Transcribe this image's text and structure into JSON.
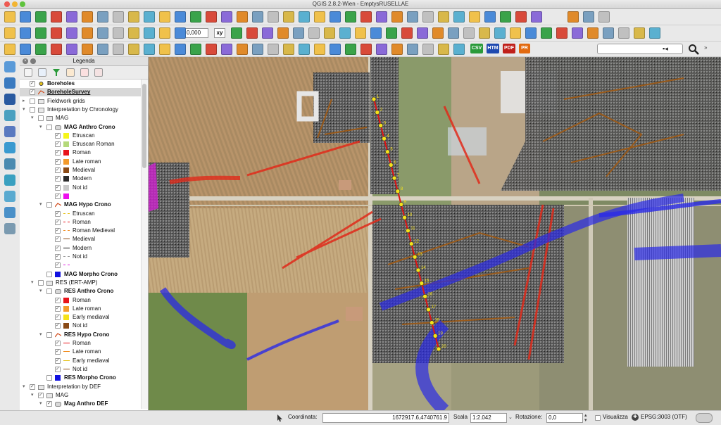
{
  "window": {
    "title": "QGIS 2.8.2-Wien - EmptysRUSELLAE"
  },
  "toolbar": {
    "zoom_factor": "0,000",
    "xy_button": "xy",
    "export_buttons": [
      "CSV",
      "HTM",
      "PDF",
      "PR"
    ],
    "search_value": ""
  },
  "legend": {
    "title": "Legenda",
    "rows": [
      {
        "label": "Boreholes",
        "indent": 0,
        "checked": true,
        "bold": true,
        "type": "point-layer"
      },
      {
        "label": "BoreholeSurvey",
        "indent": 0,
        "checked": true,
        "bold": true,
        "underline": true,
        "selected": true,
        "type": "line-layer"
      },
      {
        "label": "Fieldwork grids",
        "indent": 0,
        "checked": false,
        "type": "group",
        "expander": "▸"
      },
      {
        "label": "Interpretation by Chronology",
        "indent": 0,
        "checked": false,
        "type": "group",
        "expander": "▾"
      },
      {
        "label": "MAG",
        "indent": 1,
        "checked": false,
        "type": "group",
        "expander": "▾"
      },
      {
        "label": "MAG Anthro Crono",
        "indent": 2,
        "checked": false,
        "bold": true,
        "type": "polygon-layer",
        "expander": "▾"
      },
      {
        "label": "Etruscan",
        "indent": 3,
        "checked": true,
        "swatch": "#f5f51a"
      },
      {
        "label": "Etruscan Roman",
        "indent": 3,
        "checked": true,
        "swatch": "#b4d97a"
      },
      {
        "label": "Roman",
        "indent": 3,
        "checked": true,
        "swatch": "#e8141a"
      },
      {
        "label": "Late roman",
        "indent": 3,
        "checked": true,
        "swatch": "#f39a2b"
      },
      {
        "label": "Medieval",
        "indent": 3,
        "checked": true,
        "swatch": "#8a4a16"
      },
      {
        "label": "Modern",
        "indent": 3,
        "checked": true,
        "swatch": "#2b2b2b"
      },
      {
        "label": "Not id",
        "indent": 3,
        "checked": true,
        "swatch": "#c9c9c9"
      },
      {
        "label": "",
        "indent": 3,
        "checked": true,
        "swatch": "#ee10ee"
      },
      {
        "label": "MAG Hypo Crono",
        "indent": 2,
        "checked": false,
        "bold": true,
        "type": "line-layer",
        "expander": "▾"
      },
      {
        "label": "Etruscan",
        "indent": 3,
        "checked": true,
        "line": "#e6c21a",
        "dash": "dashed"
      },
      {
        "label": "Roman",
        "indent": 3,
        "checked": true,
        "line": "#e8141a",
        "dash": "dashed"
      },
      {
        "label": "Roman Medieval",
        "indent": 3,
        "checked": true,
        "line": "#f08a1a",
        "dash": "dashed"
      },
      {
        "label": "Medieval",
        "indent": 3,
        "checked": true,
        "line": "#8a4a16",
        "dash": "solid"
      },
      {
        "label": "Modern",
        "indent": 3,
        "checked": true,
        "line": "#111111",
        "dash": "solid"
      },
      {
        "label": "Not id",
        "indent": 3,
        "checked": true,
        "line": "#9a9a9a",
        "dash": "dashed"
      },
      {
        "label": "",
        "indent": 3,
        "checked": true,
        "line": "#e01ee0",
        "dash": "dashed"
      },
      {
        "label": "MAG Morpho Crono",
        "indent": 2,
        "checked": false,
        "bold": true,
        "swatch": "#1212e0"
      },
      {
        "label": "RES (ERT-AMP)",
        "indent": 1,
        "checked": false,
        "type": "group",
        "expander": "▾"
      },
      {
        "label": "RES Anthro Crono",
        "indent": 2,
        "checked": false,
        "bold": true,
        "type": "polygon-layer",
        "expander": "▾"
      },
      {
        "label": "Roman",
        "indent": 3,
        "checked": true,
        "swatch": "#e8141a"
      },
      {
        "label": "Late roman",
        "indent": 3,
        "checked": true,
        "swatch": "#f39a2b"
      },
      {
        "label": "Early mediaval",
        "indent": 3,
        "checked": true,
        "swatch": "#f5e21a"
      },
      {
        "label": "Not id",
        "indent": 3,
        "checked": true,
        "swatch": "#8a4a16"
      },
      {
        "label": "RES Hypo Crono",
        "indent": 2,
        "checked": false,
        "bold": true,
        "type": "line-layer",
        "expander": "▾"
      },
      {
        "label": "Roman",
        "indent": 3,
        "checked": true,
        "line": "#e8141a",
        "dash": "solid"
      },
      {
        "label": "Late roman",
        "indent": 3,
        "checked": true,
        "line": "#f08a1a",
        "dash": "solid"
      },
      {
        "label": "Early mediaval",
        "indent": 3,
        "checked": true,
        "line": "#e6c21a",
        "dash": "solid"
      },
      {
        "label": "Not id",
        "indent": 3,
        "checked": true,
        "line": "#8a4a16",
        "dash": "solid"
      },
      {
        "label": "RES Morpho Crono",
        "indent": 2,
        "checked": false,
        "bold": true,
        "swatch": "#1212e0"
      },
      {
        "label": "Interpretation by DEF",
        "indent": 0,
        "checked": true,
        "type": "group",
        "expander": "▾"
      },
      {
        "label": "MAG",
        "indent": 1,
        "checked": true,
        "type": "group",
        "expander": "▾"
      },
      {
        "label": "Mag Anthro DEF",
        "indent": 2,
        "checked": true,
        "bold": true,
        "type": "polygon-layer",
        "expander": "▾"
      }
    ]
  },
  "map": {
    "survey_labels": [
      "1",
      "2",
      "3",
      "4",
      "5",
      "6",
      "7",
      "8",
      "9",
      "10",
      "11",
      "12",
      "13",
      "14",
      "15",
      "16",
      "17",
      "18",
      "19",
      "20"
    ]
  },
  "statusbar": {
    "coord_label": "Coordinata:",
    "coord_value": "1672917.6,4740761.9",
    "scale_label": "Scala",
    "scale_value": "1:2.042",
    "rotation_label": "Rotazione:",
    "rotation_value": "0,0",
    "render_label": "Visualizza",
    "crs_label": "EPSG:3003 (OTF)"
  },
  "colors": {
    "accent": "#2f7fd8",
    "survey_line": "#e01414",
    "blue_feature": "#2a2ae6"
  }
}
